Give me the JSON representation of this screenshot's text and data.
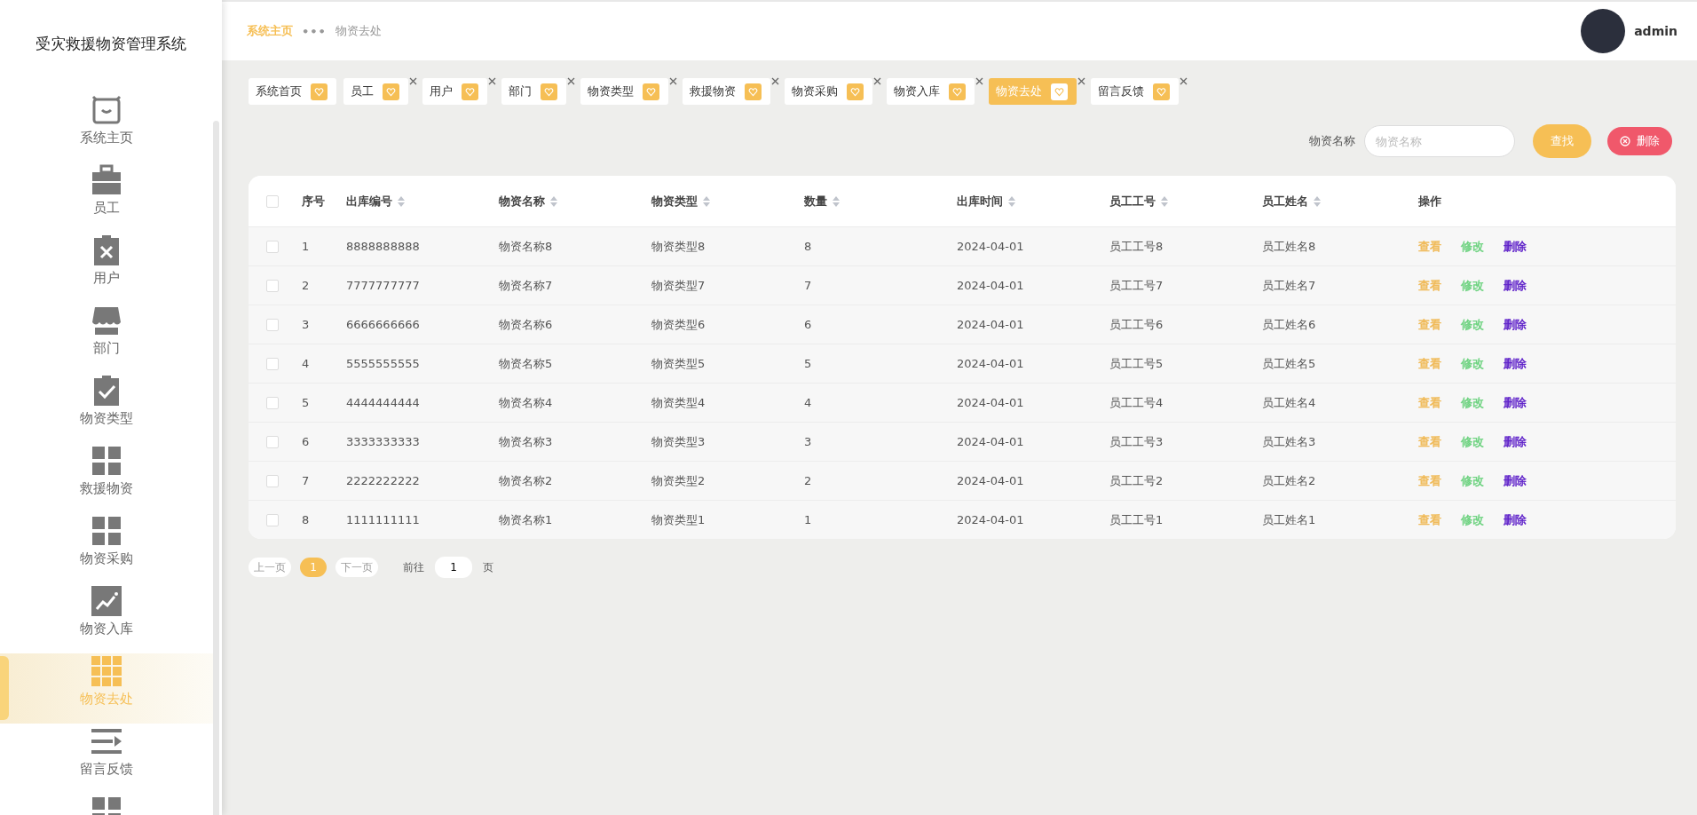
{
  "app": {
    "title": "受灾救援物资管理系统"
  },
  "sidebar": {
    "items": [
      {
        "label": "系统主页",
        "selected": false
      },
      {
        "label": "员工",
        "selected": false
      },
      {
        "label": "用户",
        "selected": false
      },
      {
        "label": "部门",
        "selected": false
      },
      {
        "label": "物资类型",
        "selected": false
      },
      {
        "label": "救援物资",
        "selected": false
      },
      {
        "label": "物资采购",
        "selected": false
      },
      {
        "label": "物资入库",
        "selected": false
      },
      {
        "label": "物资去处",
        "selected": true
      },
      {
        "label": "留言反馈",
        "selected": false
      }
    ]
  },
  "breadcrumb": {
    "home": "系统主页",
    "separator": "•••",
    "current": "物资去处"
  },
  "user": {
    "name": "admin"
  },
  "tabs": [
    {
      "label": "系统首页",
      "selected": false,
      "closable": false
    },
    {
      "label": "员工",
      "selected": false,
      "closable": true
    },
    {
      "label": "用户",
      "selected": false,
      "closable": true
    },
    {
      "label": "部门",
      "selected": false,
      "closable": true
    },
    {
      "label": "物资类型",
      "selected": false,
      "closable": true
    },
    {
      "label": "救援物资",
      "selected": false,
      "closable": true
    },
    {
      "label": "物资采购",
      "selected": false,
      "closable": true
    },
    {
      "label": "物资入库",
      "selected": false,
      "closable": true
    },
    {
      "label": "物资去处",
      "selected": true,
      "closable": true
    },
    {
      "label": "留言反馈",
      "selected": false,
      "closable": true
    }
  ],
  "search": {
    "label": "物资名称",
    "placeholder": "物资名称",
    "search_button": "查找",
    "delete_button": "删除"
  },
  "table": {
    "select_all_checked": false,
    "columns": [
      {
        "label": "序号",
        "sortable": false
      },
      {
        "label": "出库编号",
        "sortable": true
      },
      {
        "label": "物资名称",
        "sortable": true
      },
      {
        "label": "物资类型",
        "sortable": true
      },
      {
        "label": "数量",
        "sortable": true
      },
      {
        "label": "出库时间",
        "sortable": true
      },
      {
        "label": "员工工号",
        "sortable": true
      },
      {
        "label": "员工姓名",
        "sortable": true
      },
      {
        "label": "操作",
        "sortable": false
      }
    ],
    "rows": [
      {
        "checked": false,
        "cells": [
          "1",
          "8888888888",
          "物资名称8",
          "物资类型8",
          "8",
          "2024-04-01",
          "员工工号8",
          "员工姓名8"
        ],
        "actions": [
          {
            "label": "查看",
            "color": "#f0b955"
          },
          {
            "label": "修改",
            "color": "#6cd27f"
          },
          {
            "label": "删除",
            "color": "#5b1cc8"
          }
        ]
      },
      {
        "checked": false,
        "cells": [
          "2",
          "7777777777",
          "物资名称7",
          "物资类型7",
          "7",
          "2024-04-01",
          "员工工号7",
          "员工姓名7"
        ],
        "actions": [
          {
            "label": "查看",
            "color": "#f0b955"
          },
          {
            "label": "修改",
            "color": "#6cd27f"
          },
          {
            "label": "删除",
            "color": "#5b1cc8"
          }
        ]
      },
      {
        "checked": false,
        "cells": [
          "3",
          "6666666666",
          "物资名称6",
          "物资类型6",
          "6",
          "2024-04-01",
          "员工工号6",
          "员工姓名6"
        ],
        "actions": [
          {
            "label": "查看",
            "color": "#f0b955"
          },
          {
            "label": "修改",
            "color": "#6cd27f"
          },
          {
            "label": "删除",
            "color": "#5b1cc8"
          }
        ]
      },
      {
        "checked": false,
        "cells": [
          "4",
          "5555555555",
          "物资名称5",
          "物资类型5",
          "5",
          "2024-04-01",
          "员工工号5",
          "员工姓名5"
        ],
        "actions": [
          {
            "label": "查看",
            "color": "#f0b955"
          },
          {
            "label": "修改",
            "color": "#6cd27f"
          },
          {
            "label": "删除",
            "color": "#5b1cc8"
          }
        ]
      },
      {
        "checked": false,
        "cells": [
          "5",
          "4444444444",
          "物资名称4",
          "物资类型4",
          "4",
          "2024-04-01",
          "员工工号4",
          "员工姓名4"
        ],
        "actions": [
          {
            "label": "查看",
            "color": "#f0b955"
          },
          {
            "label": "修改",
            "color": "#6cd27f"
          },
          {
            "label": "删除",
            "color": "#5b1cc8"
          }
        ]
      },
      {
        "checked": false,
        "cells": [
          "6",
          "3333333333",
          "物资名称3",
          "物资类型3",
          "3",
          "2024-04-01",
          "员工工号3",
          "员工姓名3"
        ],
        "actions": [
          {
            "label": "查看",
            "color": "#f0b955"
          },
          {
            "label": "修改",
            "color": "#6cd27f"
          },
          {
            "label": "删除",
            "color": "#5b1cc8"
          }
        ]
      },
      {
        "checked": false,
        "cells": [
          "7",
          "2222222222",
          "物资名称2",
          "物资类型2",
          "2",
          "2024-04-01",
          "员工工号2",
          "员工姓名2"
        ],
        "actions": [
          {
            "label": "查看",
            "color": "#f0b955"
          },
          {
            "label": "修改",
            "color": "#6cd27f"
          },
          {
            "label": "删除",
            "color": "#5b1cc8"
          }
        ]
      },
      {
        "checked": false,
        "cells": [
          "8",
          "1111111111",
          "物资名称1",
          "物资类型1",
          "1",
          "2024-04-01",
          "员工工号1",
          "员工姓名1"
        ],
        "actions": [
          {
            "label": "查看",
            "color": "#f0b955"
          },
          {
            "label": "修改",
            "color": "#6cd27f"
          },
          {
            "label": "删除",
            "color": "#5b1cc8"
          }
        ]
      }
    ]
  },
  "pagination": {
    "prev": "上一页",
    "pages": [
      {
        "label": "1",
        "selected": true
      }
    ],
    "next": "下一页",
    "goto_label": "前往",
    "goto_value": "1",
    "goto_suffix": "页"
  }
}
